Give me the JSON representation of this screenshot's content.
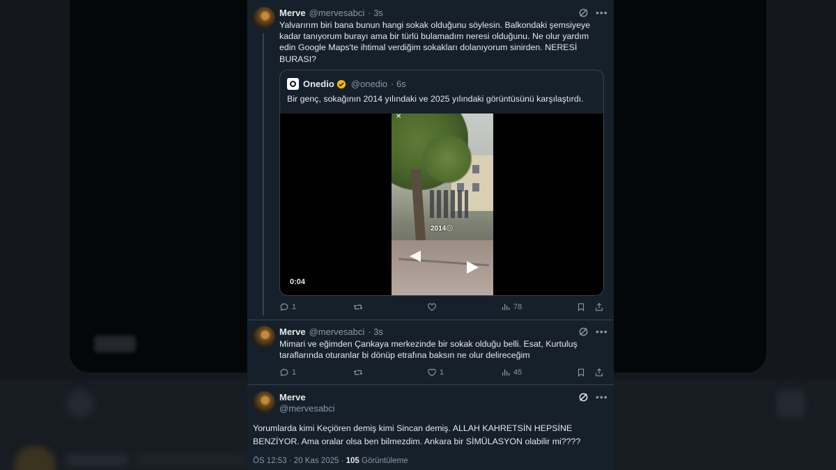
{
  "tweet1": {
    "name": "Merve",
    "handle": "@mervesabci",
    "time": "· 3s",
    "text": "Yalvarırım biri bana bunun hangi sokak olduğunu söylesin. Balkondaki şemsiyeye kadar tanıyorum burayı ama bir türlü bulamadım neresi olduğunu. Ne olur yardım edin Google Maps'te ihtimal verdiğim sokakları dolanıyorum sinirden. NERESİ BURASI?",
    "replies": "1",
    "retweets": "",
    "likes": "",
    "views": "78"
  },
  "quote": {
    "name": "Onedio",
    "handle": "@onedio",
    "time": "· 6s",
    "text": "Bir genç, sokağının 2014 yılındaki ve 2025 yılındaki görüntüsünü karşılaştırdı.",
    "video_overlay": "2014😐",
    "video_time": "0:04"
  },
  "tweet2": {
    "name": "Merve",
    "handle": "@mervesabci",
    "time": "· 3s",
    "text": "Mimari ve eğimden Çankaya merkezinde bir sokak olduğu belli. Esat, Kurtuluş taraflarında oturanlar bi dönüp etrafına baksın ne olur delireceğim",
    "replies": "1",
    "retweets": "",
    "likes": "1",
    "views": "45"
  },
  "tweet3": {
    "name": "Merve",
    "handle": "@mervesabci",
    "text": "Yorumlarda kimi Keçiören demiş kimi Sincan demiş. ALLAH KAHRETSİN HEPSİNE BENZİYOR. Ama oralar olsa ben bilmezdim. Ankara bir SİMÜLASYON olabilir mi????",
    "timestamp": "ÖS 12:53 · 20 Kas 2025 ·",
    "views_count": "105",
    "views_label": "Görüntüleme"
  },
  "colors": {
    "panel_bg": "#15202b",
    "text": "#e7e9ea",
    "muted": "#8b98a5",
    "border": "#38444d",
    "verified": "#f5b705"
  },
  "icons": [
    "grok-icon",
    "more-icon",
    "reply-icon",
    "retweet-icon",
    "like-icon",
    "views-icon",
    "bookmark-icon",
    "share-icon",
    "verified-badge-icon"
  ]
}
